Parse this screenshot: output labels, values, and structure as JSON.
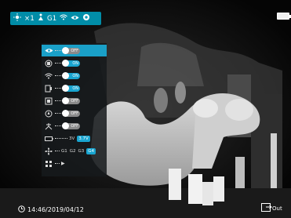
{
  "topbar": {
    "brightness_label": "1",
    "zoom_label": "×1",
    "zoom_prefix": "×",
    "mode_label": "G1",
    "icons": [
      "sun-icon",
      "zoom-icon",
      "palette-icon",
      "wifi-icon",
      "eye-icon",
      "gear-icon"
    ]
  },
  "battery": {
    "level": 1.0
  },
  "menu": {
    "rows": [
      {
        "icon": "eye-icon",
        "state": "OFF",
        "selected": true
      },
      {
        "icon": "picture-in-picture-icon",
        "state": "ON"
      },
      {
        "icon": "wifi-icon",
        "state": "ON"
      },
      {
        "icon": "calibration-icon",
        "state": "ON"
      },
      {
        "icon": "square-icon",
        "state": "OFF"
      },
      {
        "icon": "compass-icon",
        "state": "OFF"
      },
      {
        "icon": "tripod-icon",
        "state": "OFF"
      },
      {
        "icon": "battery-icon",
        "options": [
          "3V",
          "3.7V"
        ],
        "active": "3.7V"
      },
      {
        "icon": "fan-icon",
        "options": [
          "G1",
          "G2",
          "G3",
          "G4"
        ],
        "active": "G4"
      },
      {
        "icon": "menu-icon",
        "arrow": "▶"
      }
    ]
  },
  "status": {
    "datetime": "14:46/2019/04/12"
  },
  "exit": {
    "label": "Out"
  },
  "colors": {
    "accent": "#19a5d0",
    "menu_bg": "#161a1c"
  }
}
